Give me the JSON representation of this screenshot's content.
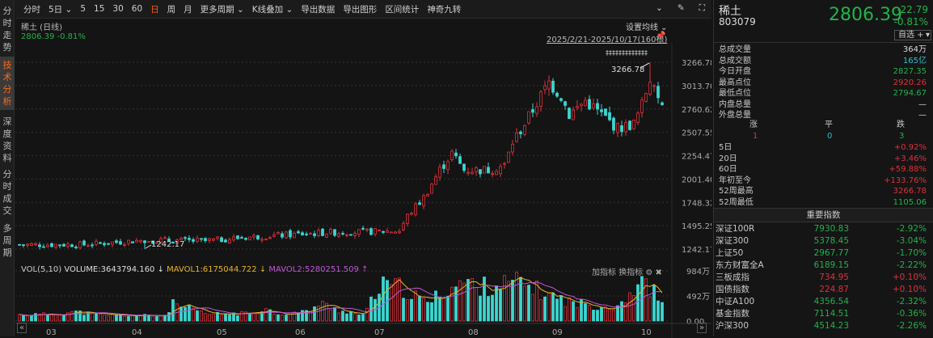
{
  "left_tabs": [
    {
      "label": "分时走势",
      "active": false
    },
    {
      "label": "技术分析",
      "active": true
    },
    {
      "label": "深度资料",
      "active": false
    },
    {
      "label": "分时成交",
      "active": false
    },
    {
      "label": "多周期",
      "active": false
    }
  ],
  "toolbar": {
    "items": [
      {
        "label": "分时"
      },
      {
        "label": "5日 ⌄"
      },
      {
        "label": "5"
      },
      {
        "label": "15"
      },
      {
        "label": "30"
      },
      {
        "label": "60"
      },
      {
        "label": "日",
        "active": true
      },
      {
        "label": "周"
      },
      {
        "label": "月"
      },
      {
        "label": "更多周期 ⌄"
      },
      {
        "label": "K线叠加 ⌄"
      },
      {
        "label": "导出数据"
      },
      {
        "label": "导出图形"
      },
      {
        "label": "区间统计"
      },
      {
        "label": "神奇九转"
      }
    ]
  },
  "chart": {
    "title": "稀土 (日线)",
    "price_line": "2806.39 -0.81%",
    "ma_setting": "设置均线 ⌄",
    "range": "2025/2/21-2025/10/17(160根)",
    "y_ticks": [
      "3266.78",
      "3013.70",
      "2760.62",
      "2507.55",
      "2254.47",
      "2001.40",
      "1748.32",
      "1495.25",
      "1242.17"
    ],
    "y_values": [
      3266.78,
      3013.7,
      2760.62,
      2507.55,
      2254.47,
      2001.4,
      1748.32,
      1495.25,
      1242.17
    ],
    "max_label": "3266.78",
    "min_label": "1242.17",
    "marker_text": "‡‡‡‡‡‡‡‡‡‡‡‡‡",
    "close_keypoints": [
      [
        0,
        1290
      ],
      [
        16,
        1290
      ],
      [
        31,
        1340
      ],
      [
        46,
        1330
      ],
      [
        56,
        1370
      ],
      [
        76,
        1420
      ],
      [
        86,
        1430
      ],
      [
        94,
        1440
      ],
      [
        96,
        1600
      ],
      [
        100,
        1800
      ],
      [
        104,
        2100
      ],
      [
        107,
        2280
      ],
      [
        110,
        2100
      ],
      [
        116,
        2100
      ],
      [
        120,
        2150
      ],
      [
        122,
        2400
      ],
      [
        125,
        2600
      ],
      [
        129,
        2900
      ],
      [
        131,
        3050
      ],
      [
        134,
        2900
      ],
      [
        136,
        2700
      ],
      [
        140,
        2850
      ],
      [
        144,
        2700
      ],
      [
        148,
        2550
      ],
      [
        152,
        2600
      ],
      [
        154,
        2800
      ],
      [
        156,
        3100
      ],
      [
        157,
        3000
      ],
      [
        159,
        2806
      ]
    ],
    "candles": 160,
    "colors": {
      "up": "#e0303a",
      "down": "#3bd6d0",
      "ma5": "#e6b422",
      "ma10": "#c058d8"
    }
  },
  "volume": {
    "header": {
      "name": "VOL(5,10)",
      "volume": "VOLUME:3643794.160 ↓",
      "mavol1": "MAVOL1:6175044.722 ↓",
      "mavol2": "MAVOL2:5280251.509 ↑",
      "add": "加指标",
      "switch": "换指标"
    },
    "y_ticks": [
      "984万",
      "492万",
      "0.00"
    ],
    "max": 984,
    "keypoints": [
      [
        0,
        120
      ],
      [
        12,
        130
      ],
      [
        20,
        180
      ],
      [
        30,
        120
      ],
      [
        40,
        110
      ],
      [
        54,
        100
      ],
      [
        57,
        330
      ],
      [
        62,
        250
      ],
      [
        70,
        130
      ],
      [
        86,
        150
      ],
      [
        90,
        260
      ],
      [
        96,
        140
      ],
      [
        106,
        170
      ],
      [
        112,
        340
      ],
      [
        118,
        220
      ],
      [
        124,
        160
      ],
      [
        128,
        100
      ],
      [
        130,
        300
      ],
      [
        133,
        600
      ],
      [
        136,
        700
      ],
      [
        142,
        650
      ],
      [
        148,
        450
      ],
      [
        152,
        350
      ],
      [
        158,
        600
      ],
      [
        166,
        780
      ],
      [
        170,
        650
      ],
      [
        176,
        700
      ],
      [
        186,
        760
      ],
      [
        196,
        520
      ],
      [
        206,
        350
      ],
      [
        214,
        300
      ],
      [
        222,
        280
      ],
      [
        228,
        600
      ],
      [
        233,
        750
      ],
      [
        239,
        364
      ]
    ],
    "months": [
      "03",
      "04",
      "05",
      "06",
      "07",
      "08",
      "09",
      "10"
    ]
  },
  "panel": {
    "name": "稀土",
    "code": "803079",
    "price": "2806.39",
    "change": "-22.79",
    "change_pct": "-0.81%",
    "watch_btn": "自选 +",
    "stats": [
      {
        "k": "总成交量",
        "v": "364万",
        "c": "w"
      },
      {
        "k": "总成交额",
        "v": "165亿",
        "c": "cy"
      },
      {
        "k": "今日开盘",
        "v": "2827.35",
        "c": "g"
      },
      {
        "k": "最高点位",
        "v": "2920.26",
        "c": "rd"
      },
      {
        "k": "最低点位",
        "v": "2794.67",
        "c": "g"
      },
      {
        "k": "内盘总量",
        "v": "—",
        "c": "w"
      },
      {
        "k": "外盘总量",
        "v": "—",
        "c": "w"
      }
    ],
    "breadth": {
      "up_label": "涨",
      "flat_label": "平",
      "down_label": "跌",
      "up": "1",
      "flat": "0",
      "down": "3"
    },
    "returns": [
      {
        "k": "5日",
        "v": "+0.92%",
        "c": "rd"
      },
      {
        "k": "20日",
        "v": "+3.46%",
        "c": "rd"
      },
      {
        "k": "60日",
        "v": "+59.88%",
        "c": "rd"
      },
      {
        "k": "年初至今",
        "v": "+133.76%",
        "c": "rd"
      },
      {
        "k": "52周最高",
        "v": "3266.78",
        "c": "rd"
      },
      {
        "k": "52周最低",
        "v": "1105.06",
        "c": "g"
      }
    ],
    "index_title": "重要指数",
    "indices": [
      {
        "n": "深证100R",
        "v": "7930.83",
        "p": "-2.92%",
        "c": "g"
      },
      {
        "n": "深证300",
        "v": "5378.45",
        "p": "-3.04%",
        "c": "g"
      },
      {
        "n": "上证50",
        "v": "2967.77",
        "p": "-1.70%",
        "c": "g"
      },
      {
        "n": "东方财富全A",
        "v": "6189.15",
        "p": "-2.22%",
        "c": "g"
      },
      {
        "n": "三板成指",
        "v": "734.95",
        "p": "+0.10%",
        "c": "rd"
      },
      {
        "n": "国债指数",
        "v": "224.87",
        "p": "+0.10%",
        "c": "rd"
      },
      {
        "n": "中证A100",
        "v": "4356.54",
        "p": "-2.32%",
        "c": "g"
      },
      {
        "n": "基金指数",
        "v": "7114.51",
        "p": "-0.36%",
        "c": "g"
      },
      {
        "n": "沪深300",
        "v": "4514.23",
        "p": "-2.26%",
        "c": "g"
      }
    ]
  }
}
